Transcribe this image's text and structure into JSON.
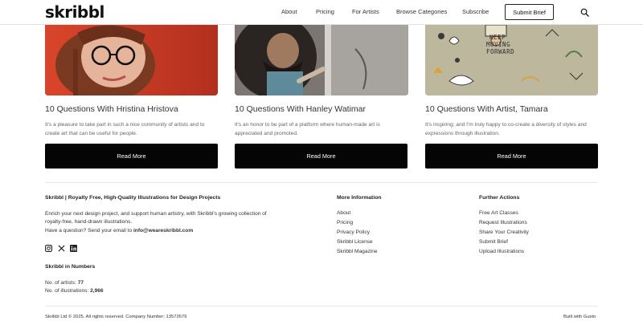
{
  "header": {
    "logo": "skribbl",
    "nav": [
      "About",
      "Pricing",
      "For Artists",
      "Browse Categories",
      "Subscribe"
    ],
    "cta": "Submit Brief"
  },
  "cards": [
    {
      "title": "10 Questions With Hristina Hristova",
      "description": "It's a pleasure to take part in such a nice community of artists and to create art that can be useful for people.",
      "button": "Read More"
    },
    {
      "title": "10 Questions With Hanley Watimar",
      "description": "It's an honor to be part of a platform where human-made art is appreciated and promoted.",
      "button": "Read More"
    },
    {
      "title": "10 Questions With Artist, Tamara",
      "description": "It's inspiring; and I'm truly happy to co-create a diversity of styles and expressions through illustration.",
      "button": "Read More",
      "image_text": [
        "KEEP",
        "MOVING",
        "FORWARD"
      ]
    }
  ],
  "footer": {
    "about_heading": "Skribbl | Royalty Free, High-Quality Illustrations for Design Projects",
    "about_line1": "Enrich your next design project, and support human artistry, with Skribbl's growing collection of",
    "about_line2": "royalty-free, hand-drawn illustrations.",
    "contact_prefix": "Have a question? Send your email to ",
    "contact_email": "info@weareskribbl.com",
    "numbers_heading": "Skribbl in Numbers",
    "artists_label": "No. of artists: ",
    "artists_value": "77",
    "illustrations_label": "No. of illustrations: ",
    "illustrations_value": "2,966",
    "more_info_heading": "More Information",
    "more_info_links": [
      "About",
      "Pricing",
      "Privacy Policy",
      "Skribbl License",
      "Skribbl Magazine"
    ],
    "actions_heading": "Further Actions",
    "actions_links": [
      "Free Art Classes",
      "Request Illustrations",
      "Share Your Creativity",
      "Submit Brief",
      "Upload Illustrations"
    ],
    "copyright": "Skribbl Ltd © 2025. All rights reserved. Company Number: 13572679",
    "built_with": "Built with Gusto"
  },
  "colors": {
    "button_bg": "#050505",
    "card1_bg": "#c8402a",
    "card3_bg": "#b9b49a"
  }
}
